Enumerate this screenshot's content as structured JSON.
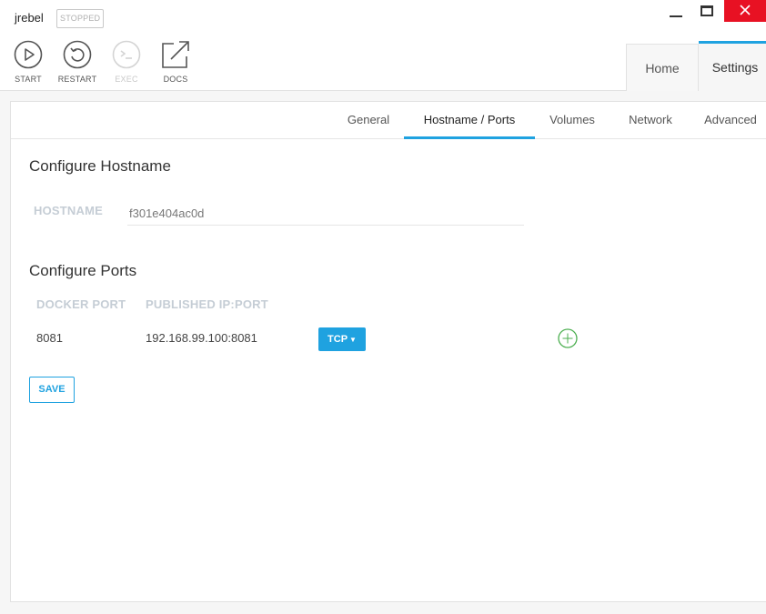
{
  "window": {
    "app_name": "jrebel",
    "status": "STOPPED"
  },
  "toolbar": {
    "start_label": "START",
    "restart_label": "RESTART",
    "exec_label": "EXEC",
    "docs_label": "DOCS"
  },
  "top_tabs": {
    "home": "Home",
    "settings": "Settings"
  },
  "sub_tabs": {
    "general": "General",
    "hostname_ports": "Hostname / Ports",
    "volumes": "Volumes",
    "network": "Network",
    "advanced": "Advanced"
  },
  "hostname_section": {
    "title": "Configure Hostname",
    "label": "HOSTNAME",
    "value": "f301e404ac0d"
  },
  "ports_section": {
    "title": "Configure Ports",
    "col_docker_port": "DOCKER PORT",
    "col_published": "PUBLISHED IP:PORT",
    "rows": [
      {
        "docker_port": "8081",
        "published": "192.168.99.100:8081",
        "protocol": "TCP"
      }
    ],
    "save_label": "SAVE"
  },
  "colors": {
    "accent": "#1fa2e0",
    "close": "#e81123",
    "add": "#4caf50"
  },
  "icons": [
    "start-icon",
    "restart-icon",
    "exec-icon",
    "docs-icon",
    "add-icon",
    "caret-down-icon"
  ]
}
